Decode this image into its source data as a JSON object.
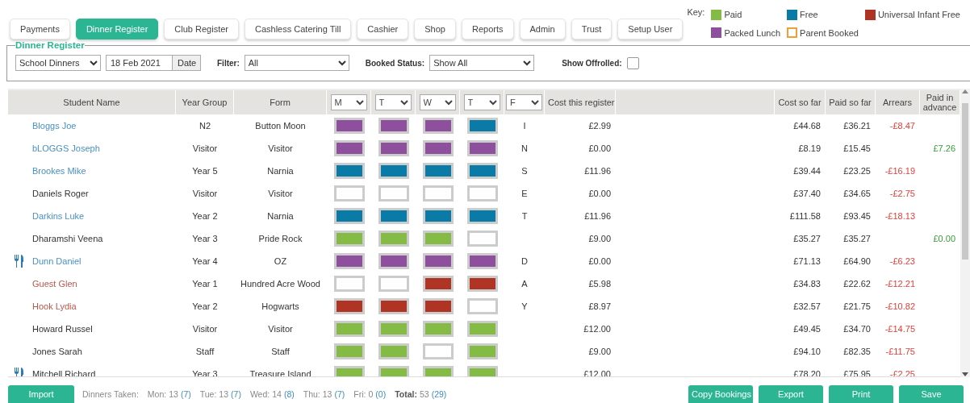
{
  "tabs": [
    {
      "label": "Payments",
      "selected": false
    },
    {
      "label": "Dinner Register",
      "selected": true
    },
    {
      "label": "Club Register",
      "selected": false
    },
    {
      "label": "Cashless Catering Till",
      "selected": false
    },
    {
      "label": "Cashier",
      "selected": false
    },
    {
      "label": "Shop",
      "selected": false
    },
    {
      "label": "Reports",
      "selected": false
    },
    {
      "label": "Admin",
      "selected": false
    },
    {
      "label": "Trust",
      "selected": false
    },
    {
      "label": "Setup User",
      "selected": false
    }
  ],
  "key": {
    "label": "Key:",
    "items": [
      {
        "label": "Paid",
        "kind": "paid"
      },
      {
        "label": "Free",
        "kind": "free"
      },
      {
        "label": "Universal Infant Free",
        "kind": "uif"
      },
      {
        "label": "Packed Lunch",
        "kind": "packed"
      },
      {
        "label": "Parent Booked",
        "kind": "parent_booked"
      }
    ]
  },
  "register": {
    "legend": "Dinner Register",
    "meal_type": "School Dinners",
    "date": "18 Feb 2021",
    "date_button": "Date",
    "filter_label": "Filter:",
    "filter": "All",
    "booked_status_label": "Booked Status:",
    "booked_status": "Show All",
    "show_offrolled_label": "Show Offrolled:",
    "show_offrolled": false
  },
  "table": {
    "columns": [
      {
        "label": "Student Name",
        "kind": "text"
      },
      {
        "label": "Year Group",
        "kind": "text"
      },
      {
        "label": "Form",
        "kind": "text"
      },
      {
        "label": "M",
        "kind": "select"
      },
      {
        "label": "T",
        "kind": "select"
      },
      {
        "label": "W",
        "kind": "select"
      },
      {
        "label": "T",
        "kind": "select"
      },
      {
        "label": "F",
        "kind": "select"
      },
      {
        "label": "Cost this register",
        "kind": "text"
      },
      {
        "label": "Cost so far",
        "kind": "text"
      },
      {
        "label": "Paid so far",
        "kind": "text"
      },
      {
        "label": "Arrears",
        "kind": "text"
      },
      {
        "label": "Paid in advance",
        "kind": "text"
      }
    ],
    "rows": [
      {
        "meal_icon": false,
        "name": "Bloggs Joe",
        "color": "#4a90c2",
        "year_group": "N2",
        "form": "Button Moon",
        "days": [
          {
            "kind": "packed"
          },
          {
            "kind": "packed"
          },
          {
            "kind": "packed"
          },
          {
            "kind": "free"
          }
        ],
        "column_f": "I",
        "cost_this_register": "£2.99",
        "cost_so_far": "£44.68",
        "paid_so_far": "£36.21",
        "arrears": "-£8.47"
      },
      {
        "meal_icon": false,
        "name": "bLOGGS Joseph",
        "color": "#4a90c2",
        "year_group": "Visitor",
        "form": "Visitor",
        "days": [
          {
            "kind": "packed"
          },
          {
            "kind": "packed"
          },
          {
            "kind": "packed"
          },
          {
            "kind": "packed"
          }
        ],
        "column_f": "N",
        "cost_this_register": "£0.00",
        "cost_so_far": "£8.19",
        "paid_so_far": "£15.45",
        "paid_in_advance": "£7.26"
      },
      {
        "meal_icon": false,
        "name": "Brookes Mike",
        "color": "#4a90c2",
        "year_group": "Year 5",
        "form": "Narnia",
        "days": [
          {
            "kind": "free"
          },
          {
            "kind": "free"
          },
          {
            "kind": "free"
          },
          {
            "kind": "free"
          }
        ],
        "column_f": "S",
        "cost_this_register": "£11.96",
        "cost_so_far": "£39.44",
        "paid_so_far": "£23.25",
        "arrears": "-£16.19"
      },
      {
        "meal_icon": false,
        "name": "Daniels Roger",
        "color": "#333333",
        "year_group": "Visitor",
        "form": "Visitor",
        "days": [
          {
            "kind": "none"
          },
          {
            "kind": "none"
          },
          {
            "kind": "none"
          },
          {
            "kind": "none"
          }
        ],
        "column_f": "E",
        "cost_this_register": "£0.00",
        "cost_so_far": "£37.40",
        "paid_so_far": "£34.65",
        "arrears": "-£2.75"
      },
      {
        "meal_icon": false,
        "name": "Darkins Luke",
        "color": "#4a90c2",
        "year_group": "Year 2",
        "form": "Narnia",
        "days": [
          {
            "kind": "free"
          },
          {
            "kind": "free"
          },
          {
            "kind": "free"
          },
          {
            "kind": "free"
          }
        ],
        "column_f": "T",
        "cost_this_register": "£11.96",
        "cost_so_far": "£111.58",
        "paid_so_far": "£93.45",
        "arrears": "-£18.13"
      },
      {
        "meal_icon": false,
        "name": "Dharamshi Veena",
        "color": "#333333",
        "year_group": "Year 3",
        "form": "Pride Rock",
        "days": [
          {
            "kind": "paid"
          },
          {
            "kind": "paid"
          },
          {
            "kind": "paid"
          },
          {
            "kind": "none"
          }
        ],
        "cost_this_register": "£9.00",
        "cost_so_far": "£35.27",
        "paid_so_far": "£35.27",
        "paid_in_advance": "£0.00"
      },
      {
        "meal_icon": true,
        "name": "Dunn Daniel",
        "color": "#4a90c2",
        "year_group": "Year 4",
        "form": "OZ",
        "days": [
          {
            "kind": "packed"
          },
          {
            "kind": "packed"
          },
          {
            "kind": "packed"
          },
          {
            "kind": "packed"
          }
        ],
        "column_f": "D",
        "cost_this_register": "£0.00",
        "cost_so_far": "£71.13",
        "paid_so_far": "£64.90",
        "arrears": "-£6.23"
      },
      {
        "meal_icon": false,
        "name": "Guest Glen",
        "color": "#b8574a",
        "year_group": "Year 1",
        "form": "Hundred Acre Wood",
        "days": [
          {
            "kind": "none"
          },
          {
            "kind": "none"
          },
          {
            "kind": "uif"
          },
          {
            "kind": "uif"
          }
        ],
        "column_f": "A",
        "cost_this_register": "£5.98",
        "cost_so_far": "£34.83",
        "paid_so_far": "£22.62",
        "arrears": "-£12.21"
      },
      {
        "meal_icon": false,
        "name": "Hook Lydia",
        "color": "#b8574a",
        "year_group": "Year 2",
        "form": "Hogwarts",
        "days": [
          {
            "kind": "uif"
          },
          {
            "kind": "uif"
          },
          {
            "kind": "uif"
          },
          {
            "kind": "none"
          }
        ],
        "column_f": "Y",
        "cost_this_register": "£8.97",
        "cost_so_far": "£32.57",
        "paid_so_far": "£21.75",
        "arrears": "-£10.82"
      },
      {
        "meal_icon": false,
        "name": "Howard Russel",
        "color": "#333333",
        "year_group": "Visitor",
        "form": "Visitor",
        "days": [
          {
            "kind": "paid"
          },
          {
            "kind": "paid"
          },
          {
            "kind": "paid"
          },
          {
            "kind": "paid"
          }
        ],
        "cost_this_register": "£12.00",
        "cost_so_far": "£49.45",
        "paid_so_far": "£34.70",
        "arrears": "-£14.75"
      },
      {
        "meal_icon": false,
        "name": "Jones Sarah",
        "color": "#333333",
        "year_group": "Staff",
        "form": "Staff",
        "days": [
          {
            "kind": "paid"
          },
          {
            "kind": "paid"
          },
          {
            "kind": "none"
          },
          {
            "kind": "paid"
          }
        ],
        "cost_this_register": "£9.00",
        "cost_so_far": "£94.10",
        "paid_so_far": "£82.35",
        "arrears": "-£11.75"
      },
      {
        "meal_icon": true,
        "name": "Mitchell Richard",
        "color": "#333333",
        "year_group": "Year 3",
        "form": "Treasure Island",
        "days": [
          {
            "kind": "paid"
          },
          {
            "kind": "paid"
          },
          {
            "kind": "paid"
          },
          {
            "kind": "paid"
          }
        ],
        "cost_this_register": "£12.00",
        "cost_so_far": "£78.20",
        "paid_so_far": "£75.95",
        "arrears": "-£2.25"
      }
    ]
  },
  "footer": {
    "import_button": "Import",
    "dinners_taken_label": "Dinners Taken:",
    "days": [
      {
        "label": "Mon:",
        "value": "13",
        "count": "(7)"
      },
      {
        "label": "Tue:",
        "value": "13",
        "count": "(7)"
      },
      {
        "label": "Wed:",
        "value": "14",
        "count": "(8)"
      },
      {
        "label": "Thu:",
        "value": "13",
        "count": "(7)"
      },
      {
        "label": "Fri:",
        "value": "0",
        "count": "(0)"
      }
    ],
    "total": {
      "label": "Total:",
      "value": "53",
      "count": "(29)"
    },
    "buttons": [
      "Copy Bookings",
      "Export",
      "Print",
      "Save"
    ]
  }
}
